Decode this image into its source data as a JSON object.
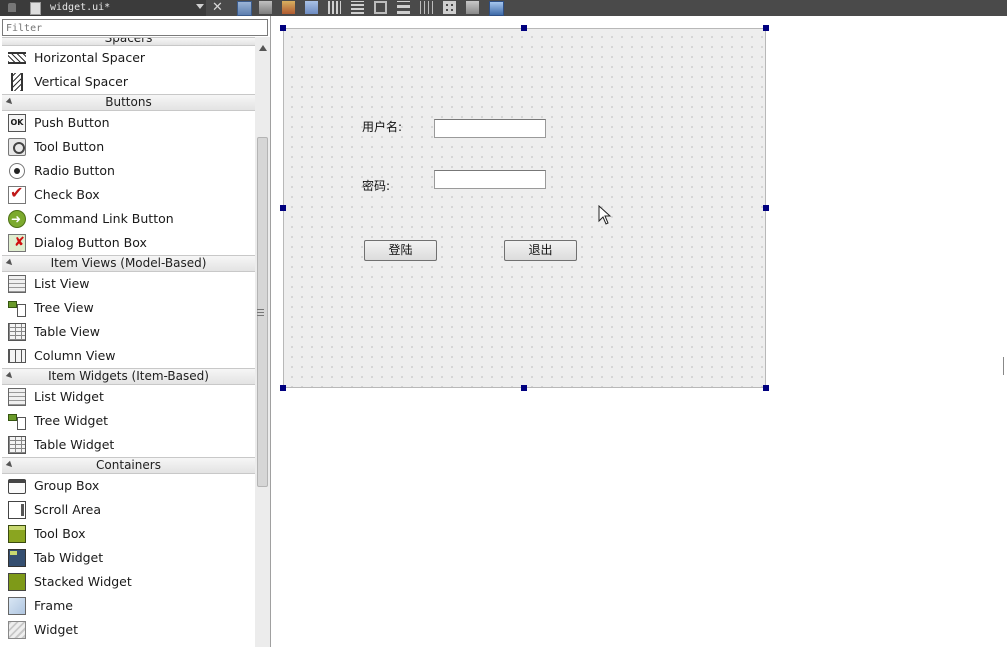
{
  "window": {
    "tab_title": "widget.ui*"
  },
  "widget_box": {
    "filter_placeholder": "Filter",
    "partial_category": "Spacers",
    "sections": [
      {
        "category": "",
        "items": [
          {
            "label": "Horizontal Spacer",
            "icon": "horizontal-spacer-icon"
          },
          {
            "label": "Vertical Spacer",
            "icon": "vertical-spacer-icon"
          }
        ]
      },
      {
        "category": "Buttons",
        "items": [
          {
            "label": "Push Button",
            "icon": "push-button-icon"
          },
          {
            "label": "Tool Button",
            "icon": "tool-button-icon"
          },
          {
            "label": "Radio Button",
            "icon": "radio-button-icon"
          },
          {
            "label": "Check Box",
            "icon": "check-box-icon"
          },
          {
            "label": "Command Link Button",
            "icon": "command-link-icon"
          },
          {
            "label": "Dialog Button Box",
            "icon": "dialog-button-box-icon"
          }
        ]
      },
      {
        "category": "Item Views (Model-Based)",
        "items": [
          {
            "label": "List View",
            "icon": "list-view-icon"
          },
          {
            "label": "Tree View",
            "icon": "tree-view-icon"
          },
          {
            "label": "Table View",
            "icon": "table-view-icon"
          },
          {
            "label": "Column View",
            "icon": "column-view-icon"
          }
        ]
      },
      {
        "category": "Item Widgets (Item-Based)",
        "items": [
          {
            "label": "List Widget",
            "icon": "list-widget-icon"
          },
          {
            "label": "Tree Widget",
            "icon": "tree-widget-icon"
          },
          {
            "label": "Table Widget",
            "icon": "table-widget-icon"
          }
        ]
      },
      {
        "category": "Containers",
        "items": [
          {
            "label": "Group Box",
            "icon": "group-box-icon"
          },
          {
            "label": "Scroll Area",
            "icon": "scroll-area-icon"
          },
          {
            "label": "Tool Box",
            "icon": "tool-box-icon"
          },
          {
            "label": "Tab Widget",
            "icon": "tab-widget-icon"
          },
          {
            "label": "Stacked Widget",
            "icon": "stacked-widget-icon"
          },
          {
            "label": "Frame",
            "icon": "frame-icon"
          },
          {
            "label": "Widget",
            "icon": "widget-icon"
          }
        ]
      }
    ]
  },
  "form": {
    "username_label": "用户名:",
    "username_value": "",
    "password_label": "密码:",
    "password_value": "",
    "login_button": "登陆",
    "exit_button": "退出"
  },
  "colors": {
    "selection_handle": "#00007f",
    "form_background": "#eeeeee",
    "toolbar_background": "#4a4a4a"
  }
}
